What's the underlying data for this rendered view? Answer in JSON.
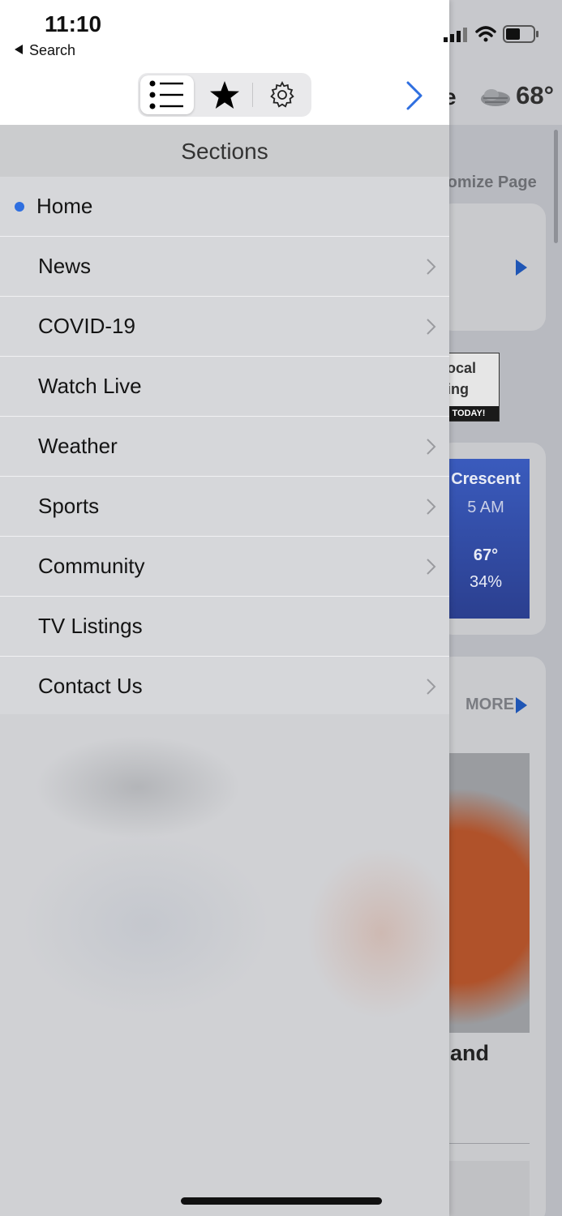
{
  "status_bar": {
    "time": "11:10",
    "back_label": "Search"
  },
  "toolbar": {
    "segments": [
      "sections-list",
      "favorites",
      "settings"
    ],
    "selected_segment": "sections-list",
    "next_icon": "chevron-right-icon"
  },
  "sections": {
    "title": "Sections",
    "items": [
      {
        "label": "Home",
        "current": true,
        "has_children": false
      },
      {
        "label": "News",
        "current": false,
        "has_children": true
      },
      {
        "label": "COVID-19",
        "current": false,
        "has_children": true
      },
      {
        "label": "Watch Live",
        "current": false,
        "has_children": false
      },
      {
        "label": "Weather",
        "current": false,
        "has_children": true
      },
      {
        "label": "Sports",
        "current": false,
        "has_children": true
      },
      {
        "label": "Community",
        "current": false,
        "has_children": true
      },
      {
        "label": "TV Listings",
        "current": false,
        "has_children": false
      },
      {
        "label": "Contact Us",
        "current": false,
        "has_children": true
      }
    ]
  },
  "background": {
    "temperature": "68°",
    "customize_partial": "tomize Page",
    "weather_card": {
      "city_partial": "Crescent",
      "time": "5 AM",
      "temp": "67°",
      "humidity": "34%"
    },
    "more_label": "MORE",
    "headline_partial": "and",
    "logo_partial_1": "ocal",
    "logo_partial_2": "ing",
    "logo_bar": "TODAY!"
  },
  "colors": {
    "accent": "#2f6fe0",
    "link_blue": "#1f56b5"
  }
}
